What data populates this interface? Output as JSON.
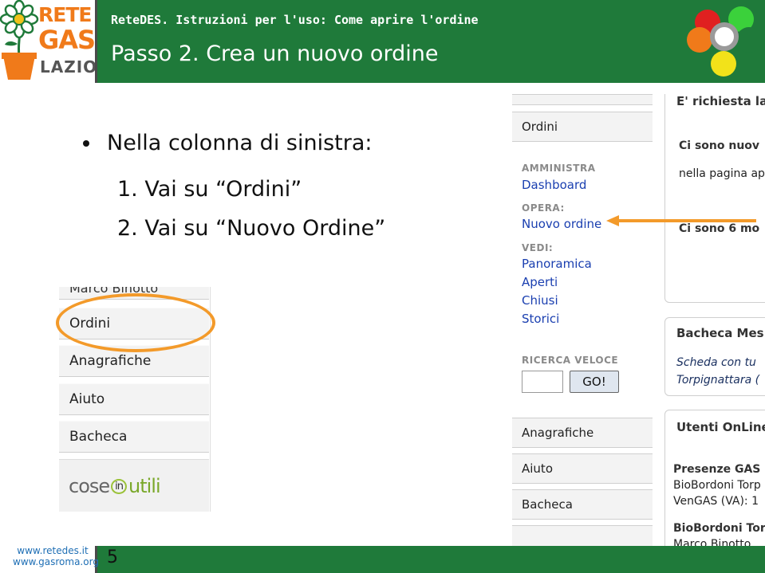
{
  "logo": {
    "line1": "RETE",
    "line2": "GAS",
    "line3": "LAZIO"
  },
  "header": {
    "subtitle": "ReteDES. Istruzioni per l'uso: Come aprire l'ordine",
    "title": "Passo 2. Crea un nuovo ordine",
    "dot_colors": [
      "#e02020",
      "#3bd13b",
      "#f07a1a",
      "#1f7a3a",
      "#f2e21a"
    ]
  },
  "content": {
    "bullet": "Nella colonna di sinistra:",
    "steps": [
      "1. Vai su “Ordini”",
      "2. Vai su “Nuovo Ordine”"
    ]
  },
  "left_menu": {
    "top_cut": "Marco Binotto",
    "items": [
      "Ordini",
      "Anagrafiche",
      "Aiuto",
      "Bacheca"
    ],
    "banner": {
      "cose": "cose",
      "in": "in",
      "utili": "utili"
    },
    "highlight_color": "#f39a2a"
  },
  "right_screenshot": {
    "menu": {
      "ordini": "Ordini",
      "amministra_head": "AMMINISTRA",
      "dashboard": "Dashboard",
      "opera_head": "OPERA:",
      "nuovo_ordine": "Nuovo ordine",
      "vedi_head": "VEDI:",
      "vedi_links": [
        "Panoramica",
        "Aperti",
        "Chiusi",
        "Storici"
      ],
      "ricerca_head": "RICERCA VELOCE",
      "go_button": "GO!",
      "bottom_items": [
        "Anagrafiche",
        "Aiuto",
        "Bacheca"
      ]
    },
    "panel1": {
      "title": "E' richiesta la",
      "line1": "Ci sono nuov",
      "line2": "nella pagina ap",
      "line3": "Ci sono 6 mo"
    },
    "panel2": {
      "title": "Bacheca Mes",
      "line1": "Scheda con tu",
      "line2": "Torpignattara ("
    },
    "panel3": {
      "title": "Utenti OnLine",
      "line1": "Presenze GAS :",
      "line2": "BioBordoni Torp",
      "line3": "VenGAS (VA): 1",
      "line4": "BioBordoni Torp",
      "line5": "Marco Binotto"
    },
    "arrow_color": "#f39a2a"
  },
  "footer": {
    "page_number": "5",
    "link1": "www.retedes.it",
    "link2": "www.gasroma.org"
  }
}
